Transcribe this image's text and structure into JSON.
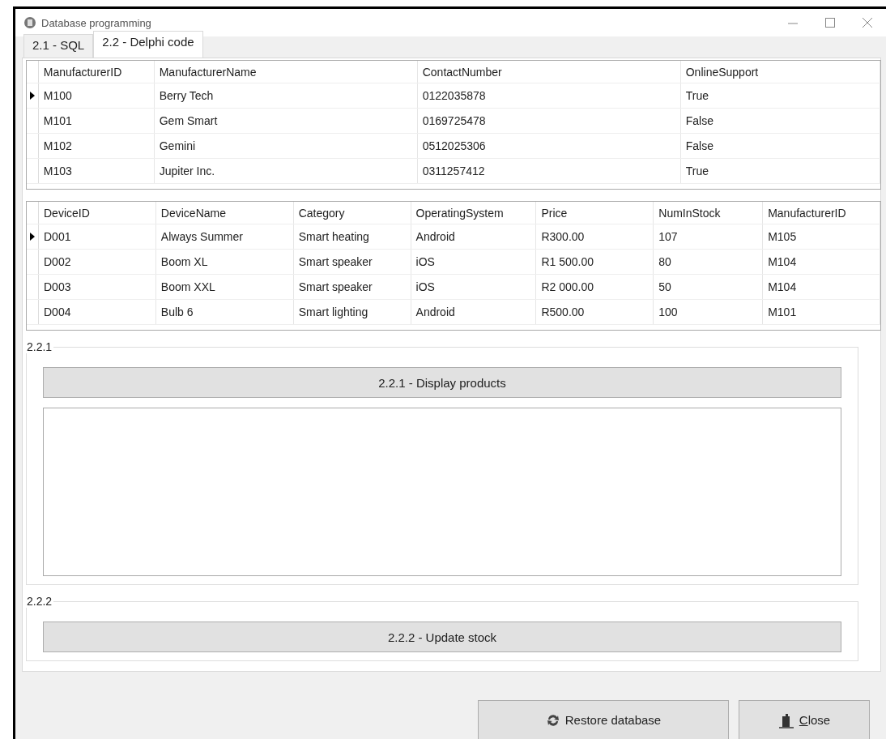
{
  "window": {
    "title": "Database programming"
  },
  "tabs": [
    {
      "label": "2.1 - SQL",
      "selected": false
    },
    {
      "label": "2.2 - Delphi code",
      "selected": true
    }
  ],
  "manufacturers": {
    "columns": [
      "ManufacturerID",
      "ManufacturerName",
      "ContactNumber",
      "OnlineSupport"
    ],
    "rows": [
      {
        "cells": [
          "M100",
          "Berry Tech",
          "0122035878",
          "True"
        ],
        "selected": true
      },
      {
        "cells": [
          "M101",
          "Gem Smart",
          "0169725478",
          "False"
        ],
        "selected": false
      },
      {
        "cells": [
          "M102",
          "Gemini",
          "0512025306",
          "False"
        ],
        "selected": false
      },
      {
        "cells": [
          "M103",
          "Jupiter Inc.",
          "0311257412",
          "True"
        ],
        "selected": false
      }
    ]
  },
  "devices": {
    "columns": [
      "DeviceID",
      "DeviceName",
      "Category",
      "OperatingSystem",
      "Price",
      "NumInStock",
      "ManufacturerID"
    ],
    "rows": [
      {
        "cells": [
          "D001",
          "Always Summer",
          "Smart heating",
          "Android",
          "R300.00",
          "107",
          "M105"
        ],
        "selected": true
      },
      {
        "cells": [
          "D002",
          "Boom XL",
          "Smart speaker",
          "iOS",
          "R1 500.00",
          "80",
          "M104"
        ],
        "selected": false
      },
      {
        "cells": [
          "D003",
          "Boom XXL",
          "Smart speaker",
          "iOS",
          "R2 000.00",
          "50",
          "M104"
        ],
        "selected": false
      },
      {
        "cells": [
          "D004",
          "Bulb 6",
          "Smart lighting",
          "Android",
          "R500.00",
          "100",
          "M101"
        ],
        "selected": false
      }
    ]
  },
  "groups": [
    {
      "caption": "2.2.1",
      "button": "2.2.1 - Display products",
      "kind": "memo"
    },
    {
      "caption": "2.2.2",
      "button": "2.2.2 - Update stock",
      "kind": "plain"
    }
  ],
  "footer_buttons": [
    {
      "label": "Restore database",
      "kind": "restore"
    },
    {
      "label": "Close",
      "kind": "close"
    }
  ]
}
